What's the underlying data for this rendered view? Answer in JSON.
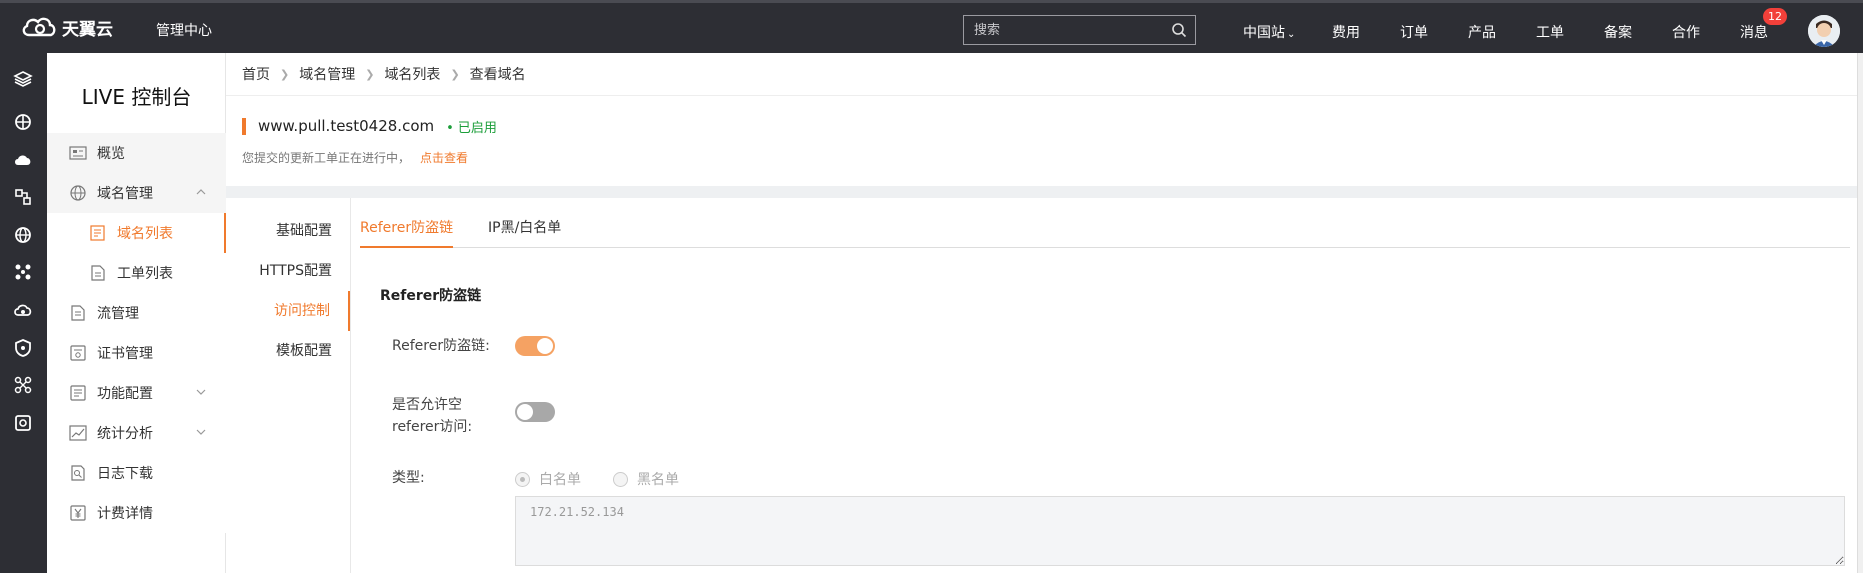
{
  "topbar": {
    "logo_text": "天翼云",
    "console_link": "管理中心",
    "search_placeholder": "搜索",
    "nav": {
      "region": "中国站",
      "fees": "费用",
      "orders": "订单",
      "products": "产品",
      "tickets": "工单",
      "filing": "备案",
      "cooperation": "合作",
      "messages": "消息"
    },
    "message_count": "12"
  },
  "sidebar": {
    "title": "LIVE 控制台",
    "items": {
      "overview": "概览",
      "domain_mgmt": "域名管理",
      "domain_list": "域名列表",
      "ticket_list": "工单列表",
      "stream_mgmt": "流管理",
      "cert_mgmt": "证书管理",
      "feature_config": "功能配置",
      "stats": "统计分析",
      "log_download": "日志下载",
      "billing": "计费详情"
    }
  },
  "breadcrumb": {
    "home": "首页",
    "domain_mgmt": "域名管理",
    "domain_list": "域名列表",
    "current": "查看域名"
  },
  "domain": {
    "name": "www.pull.test0428.com",
    "status": "• 已启用",
    "notice": "您提交的更新工单正在进行中，",
    "notice_link": "点击查看"
  },
  "subnav": {
    "basic": "基础配置",
    "https": "HTTPS配置",
    "access": "访问控制",
    "template": "模板配置"
  },
  "tabs": {
    "referer": "Referer防盗链",
    "ip_list": "IP黑/白名单"
  },
  "form": {
    "section_title": "Referer防盗链",
    "referer_label": "Referer防盗链:",
    "referer_enabled": true,
    "allow_empty_label_1": "是否允许空",
    "allow_empty_label_2": "referer访问:",
    "allow_empty_enabled": false,
    "type_label": "类型:",
    "type_whitelist": "白名单",
    "type_blacklist": "黑名单",
    "type_selected": "白名单",
    "value": "172.21.52.134"
  },
  "colors": {
    "accent": "#f07a2d",
    "topbar": "#2d2e34",
    "status_green": "#1c9e3a"
  }
}
